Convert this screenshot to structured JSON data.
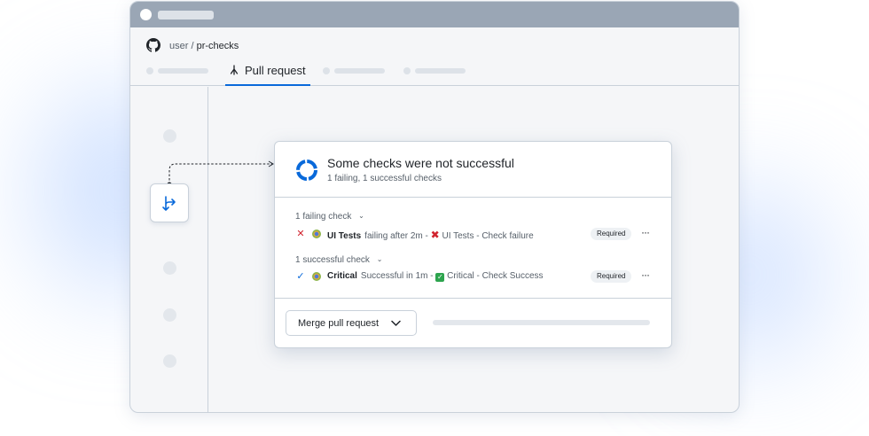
{
  "repo": {
    "owner": "user",
    "separator": "/",
    "name": "pr-checks"
  },
  "tabs": {
    "active_label": "Pull request"
  },
  "checks_card": {
    "title": "Some checks were not successful",
    "subtitle": "1 failing, 1 successful checks",
    "failing": {
      "header": "1 failing check",
      "name": "UI Tests",
      "detail": "failing after 2m - ",
      "result": "UI Tests - Check failure",
      "badge": "Required"
    },
    "successful": {
      "header": "1 successful check",
      "name": "Critical",
      "detail": "Successful in 1m - ",
      "result": "Critical - Check Success",
      "badge": "Required"
    }
  },
  "merge": {
    "button_label": "Merge pull request"
  },
  "colors": {
    "accent": "#0969da",
    "danger": "#d1242f",
    "success": "#2da44e",
    "border": "#c9d1da"
  },
  "icons": [
    "github-logo-icon",
    "pull-request-icon",
    "branch-icon",
    "progress-ring-icon",
    "x-icon",
    "check-icon",
    "chevron-down-icon",
    "kebab-icon"
  ]
}
